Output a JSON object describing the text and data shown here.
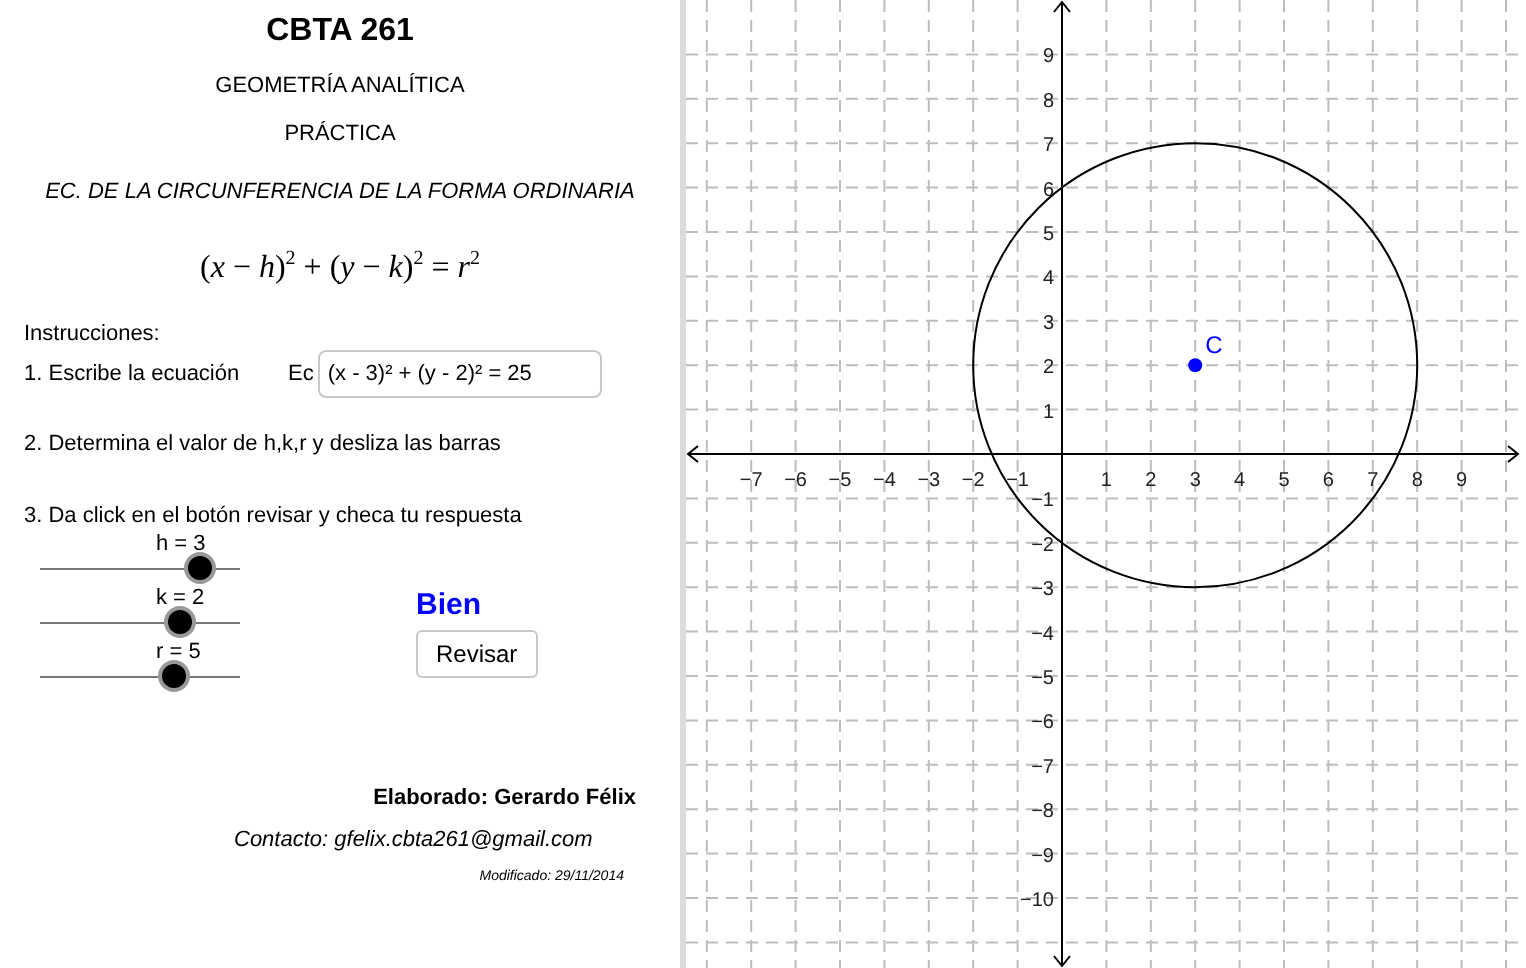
{
  "header": {
    "title": "CBTA 261",
    "subject": "GEOMETRÍA ANALÍTICA",
    "type": "PRÁCTICA",
    "topic": "EC. DE LA CIRCUNFERENCIA DE LA FORMA ORDINARIA",
    "formula": "(*x* − *h*)$^{2}$ + (*y* − *k*)$^{2}$ = *r*$^{2}$"
  },
  "instructions": {
    "heading": "Instrucciones:",
    "step_1": "1. Escribe la ecuación",
    "equation_label": "Ec",
    "equation_value": "(x - 3)² + (y - 2)² = 25",
    "step_2": "2. Determina el valor de h,k,r y desliza las barras",
    "step_3": "3. Da click en el botón revisar y checa tu respuesta"
  },
  "sliders": [
    {
      "label": "h = 3",
      "level": 0.8
    },
    {
      "label": "k = 2",
      "level": 0.7
    },
    {
      "label": "r = 5",
      "level": 0.67
    }
  ],
  "feedback": "Bien",
  "check_button": "Revisar",
  "footer": {
    "author": "Elaborado: Gerardo Félix",
    "contact": "Contacto: gfelix.cbta261@gmail.com",
    "modified": "Modificado: 29/11/2014"
  },
  "graph": {
    "x_tick_labels": [
      "−7",
      "−6",
      "−5",
      "−4",
      "−3",
      "−2",
      "−1",
      "1",
      "2",
      "3",
      "4",
      "5",
      "6",
      "7",
      "8",
      "9"
    ],
    "y_tick_labels": [
      "9",
      "8",
      "7",
      "6",
      "5",
      "4",
      "3",
      "2",
      "1",
      "−1",
      "−2",
      "−3",
      "−4",
      "−5",
      "−6",
      "−7",
      "−8",
      "−9",
      "−10"
    ],
    "point_label": "C"
  }
}
